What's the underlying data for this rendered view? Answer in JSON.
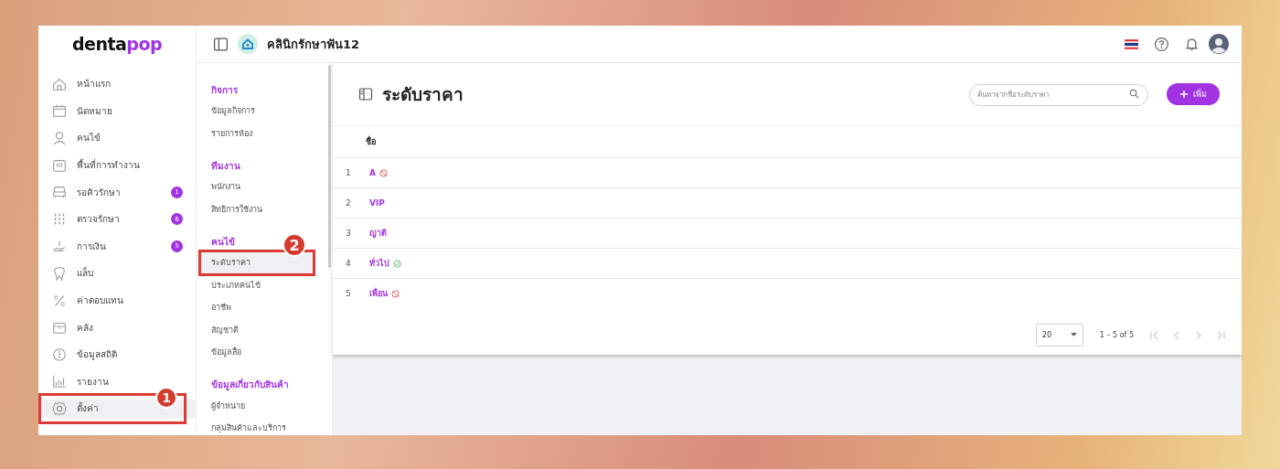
{
  "logo": {
    "part_1": "denta",
    "part_2": "pop"
  },
  "topbar": {
    "clinic": "คลินิกรักษาฟัน12"
  },
  "sidebar": {
    "items": [
      {
        "label": "หน้าแรก",
        "selected": false
      },
      {
        "label": "นัดหมาย",
        "selected": false
      },
      {
        "label": "คนไข้",
        "selected": false
      },
      {
        "label": "พื้นที่การทำงาน",
        "selected": false
      },
      {
        "label": "รอคิวรักษา",
        "selected": false,
        "badge": "1"
      },
      {
        "label": "ตรวจรักษา",
        "selected": false,
        "badge": "6"
      },
      {
        "label": "การเงิน",
        "selected": false,
        "badge": "5"
      },
      {
        "label": "แล็บ",
        "selected": false
      },
      {
        "label": "ค่าตอบแทน",
        "selected": false
      },
      {
        "label": "คลัง",
        "selected": false
      },
      {
        "label": "ข้อมูลสถิติ",
        "selected": false
      },
      {
        "label": "รายงาน",
        "selected": false
      },
      {
        "label": "ตั้งค่า",
        "selected": true,
        "callout": "1"
      }
    ]
  },
  "submenu": {
    "sections": [
      {
        "title": "กิจการ",
        "items": [
          {
            "label": "ข้อมูลกิจการ",
            "selected": false
          },
          {
            "label": "รายการห้อง",
            "selected": false
          }
        ]
      },
      {
        "title": "ทีมงาน",
        "items": [
          {
            "label": "พนักงาน",
            "selected": false
          },
          {
            "label": "สิทธิการใช้งาน",
            "selected": false
          }
        ]
      },
      {
        "title": "คนไข้",
        "items": [
          {
            "label": "ระดับราคา",
            "selected": true,
            "callout": "2"
          },
          {
            "label": "ประเภทคนไข้",
            "selected": false
          },
          {
            "label": "อาชีพ",
            "selected": false
          },
          {
            "label": "สัญชาติ",
            "selected": false
          },
          {
            "label": "ข้อมูลสื่อ",
            "selected": false
          }
        ]
      },
      {
        "title": "ข้อมูลเกี่ยวกับสินค้า",
        "items": [
          {
            "label": "ผู้จำหน่าย",
            "selected": false
          },
          {
            "label": "กลุ่มสินค้าและบริการ",
            "selected": false
          }
        ]
      }
    ]
  },
  "page": {
    "title": "ระดับราคา",
    "search": {
      "placeholder": "ค้นหาจากชื่อระดับราคา"
    },
    "add_button": "เพิ่ม"
  },
  "table": {
    "columns": [
      "ชื่อ"
    ],
    "rows": [
      {
        "index": "1",
        "name": "A",
        "disabled": true,
        "default": false
      },
      {
        "index": "2",
        "name": "VIP",
        "disabled": false,
        "default": false
      },
      {
        "index": "3",
        "name": "ญาติ",
        "disabled": false,
        "default": false
      },
      {
        "index": "4",
        "name": "ทั่วไป",
        "disabled": false,
        "default": true
      },
      {
        "index": "5",
        "name": "เพื่อน",
        "disabled": true,
        "default": false
      }
    ]
  },
  "pagination": {
    "page_size": "20",
    "range": "1 – 5 of 5"
  }
}
